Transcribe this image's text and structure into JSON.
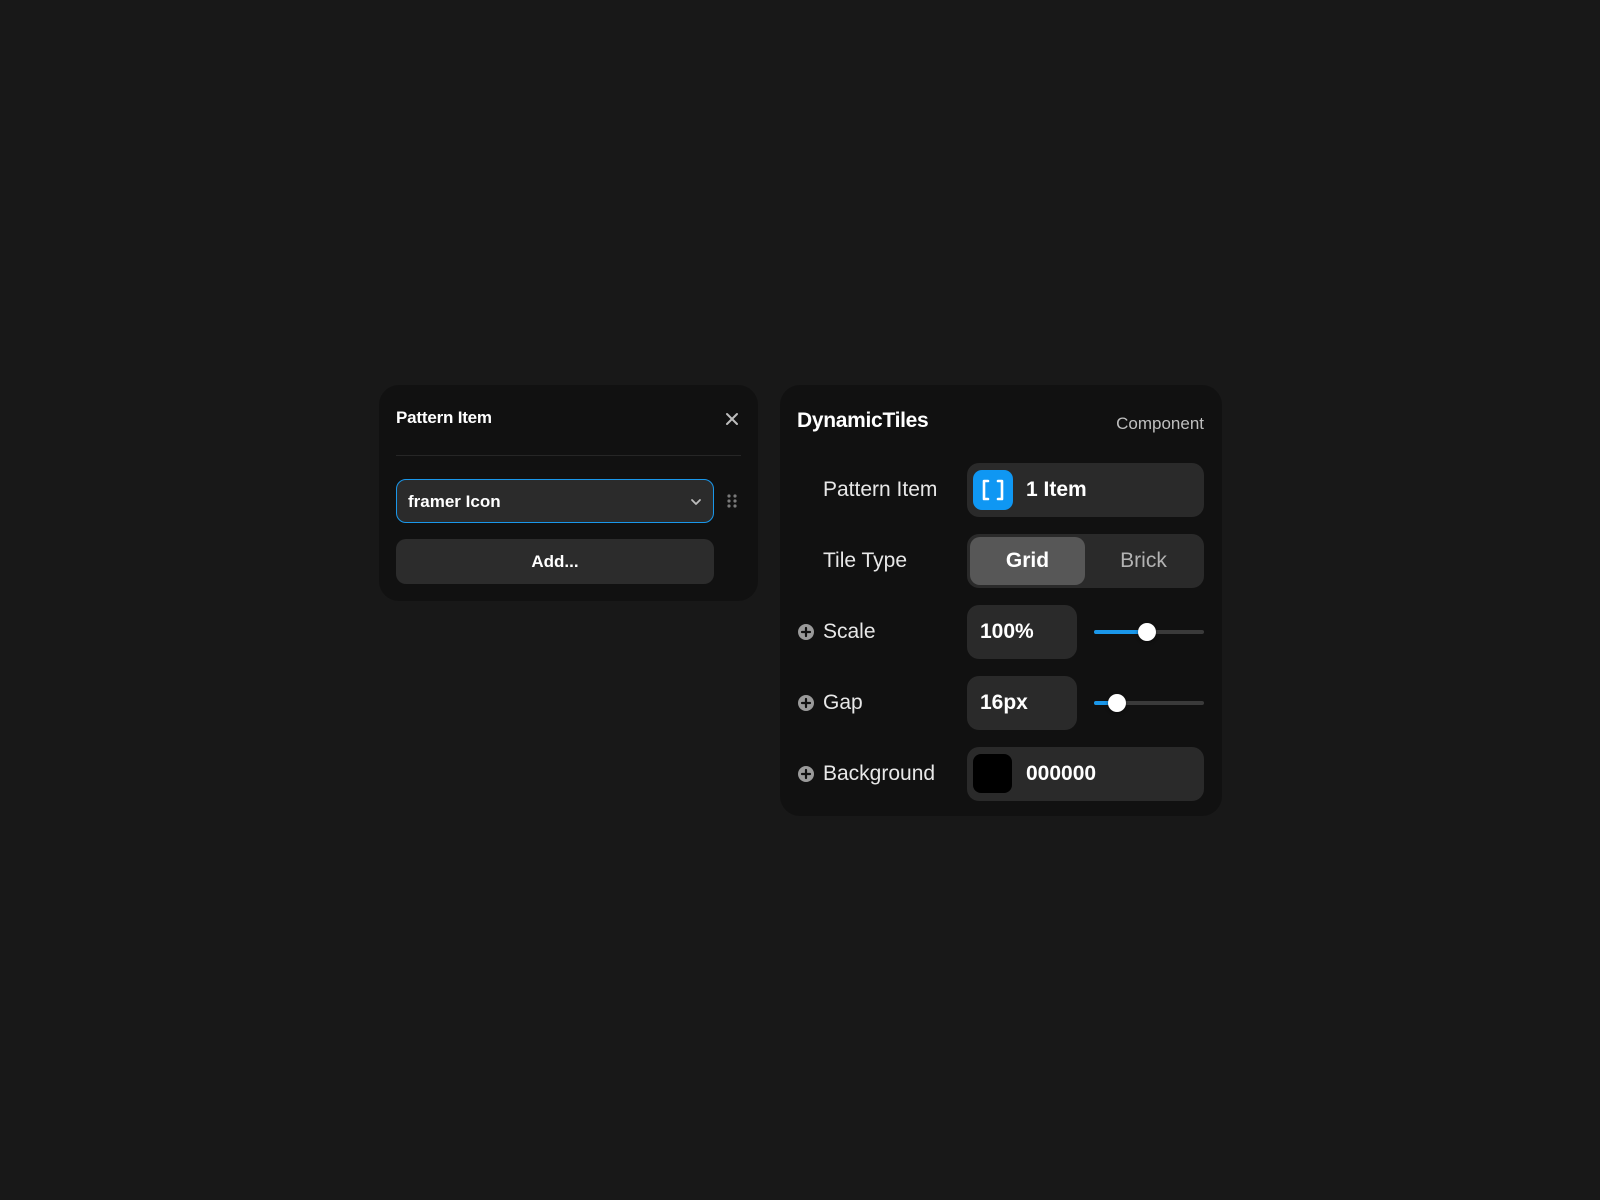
{
  "pattern_popover": {
    "title": "Pattern Item",
    "close_icon": "close-icon",
    "select_value": "framer Icon",
    "select_icon": "chevron-down-icon",
    "drag_icon": "drag-handle-icon",
    "add_label": "Add..."
  },
  "properties_panel": {
    "title": "DynamicTiles",
    "subtitle": "Component",
    "rows": {
      "pattern_item": {
        "label": "Pattern Item",
        "icon": "array-brackets-icon",
        "value": "1 Item"
      },
      "tile_type": {
        "label": "Tile Type",
        "options": [
          "Grid",
          "Brick"
        ],
        "selected": "Grid"
      },
      "scale": {
        "label": "Scale",
        "value": "100%",
        "slider_fraction": 0.48
      },
      "gap": {
        "label": "Gap",
        "value": "16px",
        "slider_fraction": 0.21
      },
      "background": {
        "label": "Background",
        "value": "000000",
        "swatch_color": "#000000"
      }
    },
    "plus_icon": "plus-circle-icon"
  },
  "colors": {
    "accent": "#1a97ea",
    "panel_bg": "#111111",
    "page_bg": "#181818"
  }
}
